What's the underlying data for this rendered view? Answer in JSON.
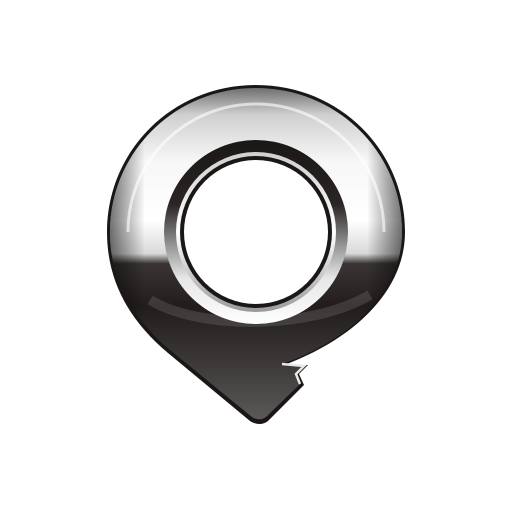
{
  "logo": {
    "name": "chrome-location-pin-logo",
    "colors": {
      "background": "#ffffff",
      "chrome_light": "#f4f4f4",
      "chrome_mid": "#a9a9a9",
      "chrome_dark": "#1e1a19",
      "inner_hole": "#ffffff"
    }
  }
}
